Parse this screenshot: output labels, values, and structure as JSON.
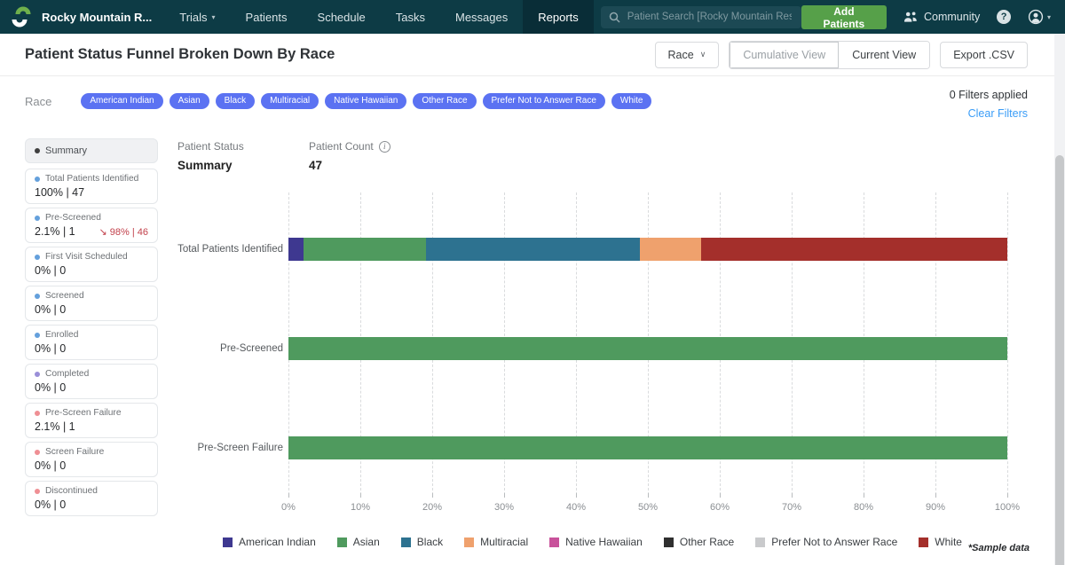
{
  "navbar": {
    "brand": "Rocky Mountain R...",
    "items": [
      {
        "label": "Trials",
        "caret": true
      },
      {
        "label": "Patients"
      },
      {
        "label": "Schedule"
      },
      {
        "label": "Tasks"
      },
      {
        "label": "Messages"
      },
      {
        "label": "Reports",
        "active": true
      }
    ],
    "search_placeholder": "Patient Search [Rocky Mountain Research C...",
    "add_patients": "Add Patients",
    "community": "Community",
    "help_glyph": "?"
  },
  "header": {
    "title": "Patient Status Funnel Broken Down By Race",
    "race_button": "Race",
    "cumulative_view": "Cumulative View",
    "current_view": "Current View",
    "export_csv": "Export .CSV"
  },
  "filter_bar": {
    "label": "Race",
    "chips": [
      "American Indian",
      "Asian",
      "Black",
      "Multiracial",
      "Native Hawaiian",
      "Other Race",
      "Prefer Not to Answer Race",
      "White"
    ],
    "chip_color": "#5b72f2",
    "filters_applied": "0 Filters applied",
    "clear_filters": "Clear Filters"
  },
  "sidebar": {
    "items": [
      {
        "label": "Summary",
        "selected": true,
        "dot": "#3f3f3f"
      },
      {
        "label": "Total Patients Identified",
        "value": "100% | 47",
        "dot": "#64a0dc"
      },
      {
        "label": "Pre-Screened",
        "value": "2.1% | 1",
        "delta_arrow": "↘",
        "delta": "98% | 46",
        "dot": "#64a0dc"
      },
      {
        "label": "First Visit Scheduled",
        "value": "0% | 0",
        "dot": "#64a0dc"
      },
      {
        "label": "Screened",
        "value": "0% | 0",
        "dot": "#64a0dc"
      },
      {
        "label": "Enrolled",
        "value": "0% | 0",
        "dot": "#64a0dc"
      },
      {
        "label": "Completed",
        "value": "0% | 0",
        "dot": "#9a8fd8"
      },
      {
        "label": "Pre-Screen Failure",
        "value": "2.1% | 1",
        "dot": "#ef8f94"
      },
      {
        "label": "Screen Failure",
        "value": "0% | 0",
        "dot": "#ef8f94"
      },
      {
        "label": "Discontinued",
        "value": "0% | 0",
        "dot": "#ef8f94"
      }
    ]
  },
  "chart_header": {
    "status_label": "Patient Status",
    "status_value": "Summary",
    "count_label": "Patient Count",
    "count_value": "47",
    "info_glyph": "i"
  },
  "chart_data": {
    "type": "bar",
    "orientation": "horizontal",
    "stacked": true,
    "x_unit": "percent of patients",
    "xlim": [
      0,
      100
    ],
    "x_ticks": [
      "0%",
      "10%",
      "20%",
      "30%",
      "40%",
      "50%",
      "60%",
      "70%",
      "80%",
      "90%",
      "100%"
    ],
    "grid": "vertical-dashed",
    "legend_position": "bottom",
    "categories": [
      "Total Patients Identified",
      "Pre-Screened",
      "Pre-Screen Failure"
    ],
    "series": [
      {
        "name": "American Indian",
        "color": "#3e3890",
        "values": [
          2.1,
          0,
          0
        ]
      },
      {
        "name": "Asian",
        "color": "#4f9a5e",
        "values": [
          17.0,
          100,
          100
        ]
      },
      {
        "name": "Black",
        "color": "#2d7290",
        "values": [
          29.8,
          0,
          0
        ]
      },
      {
        "name": "Multiracial",
        "color": "#efa16d",
        "values": [
          8.5,
          0,
          0
        ]
      },
      {
        "name": "Native Hawaiian",
        "color": "#c8529b",
        "values": [
          0,
          0,
          0
        ]
      },
      {
        "name": "Other Race",
        "color": "#2f2f2f",
        "values": [
          0,
          0,
          0
        ]
      },
      {
        "name": "Prefer Not to Answer Race",
        "color": "#c9cacc",
        "values": [
          0,
          0,
          0
        ]
      },
      {
        "name": "White",
        "color": "#a42f2b",
        "values": [
          42.6,
          0,
          0
        ]
      }
    ]
  },
  "footnote": "*Sample data"
}
